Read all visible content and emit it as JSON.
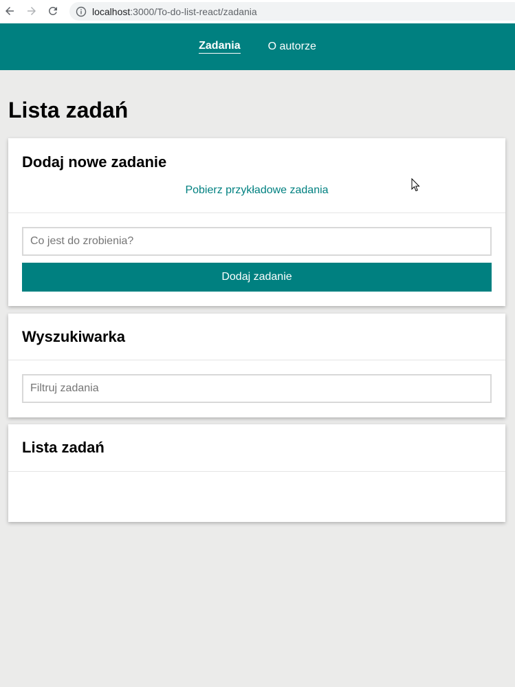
{
  "browser": {
    "url_host": "localhost",
    "url_path": ":3000/To-do-list-react/zadania"
  },
  "nav": {
    "items": [
      {
        "label": "Zadania",
        "active": true
      },
      {
        "label": "O autorze",
        "active": false
      }
    ]
  },
  "page": {
    "title": "Lista zadań"
  },
  "add_section": {
    "heading": "Dodaj nowe zadanie",
    "sample_button": "Pobierz przykładowe zadania",
    "input_placeholder": "Co jest do zrobienia?",
    "submit_label": "Dodaj zadanie"
  },
  "search_section": {
    "heading": "Wyszukiwarka",
    "input_placeholder": "Filtruj zadania"
  },
  "list_section": {
    "heading": "Lista zadań"
  },
  "colors": {
    "accent": "#008080",
    "background": "#ebebea"
  },
  "icons": [
    "back-arrow-icon",
    "forward-arrow-icon",
    "reload-icon",
    "info-icon",
    "mouse-cursor-icon"
  ]
}
